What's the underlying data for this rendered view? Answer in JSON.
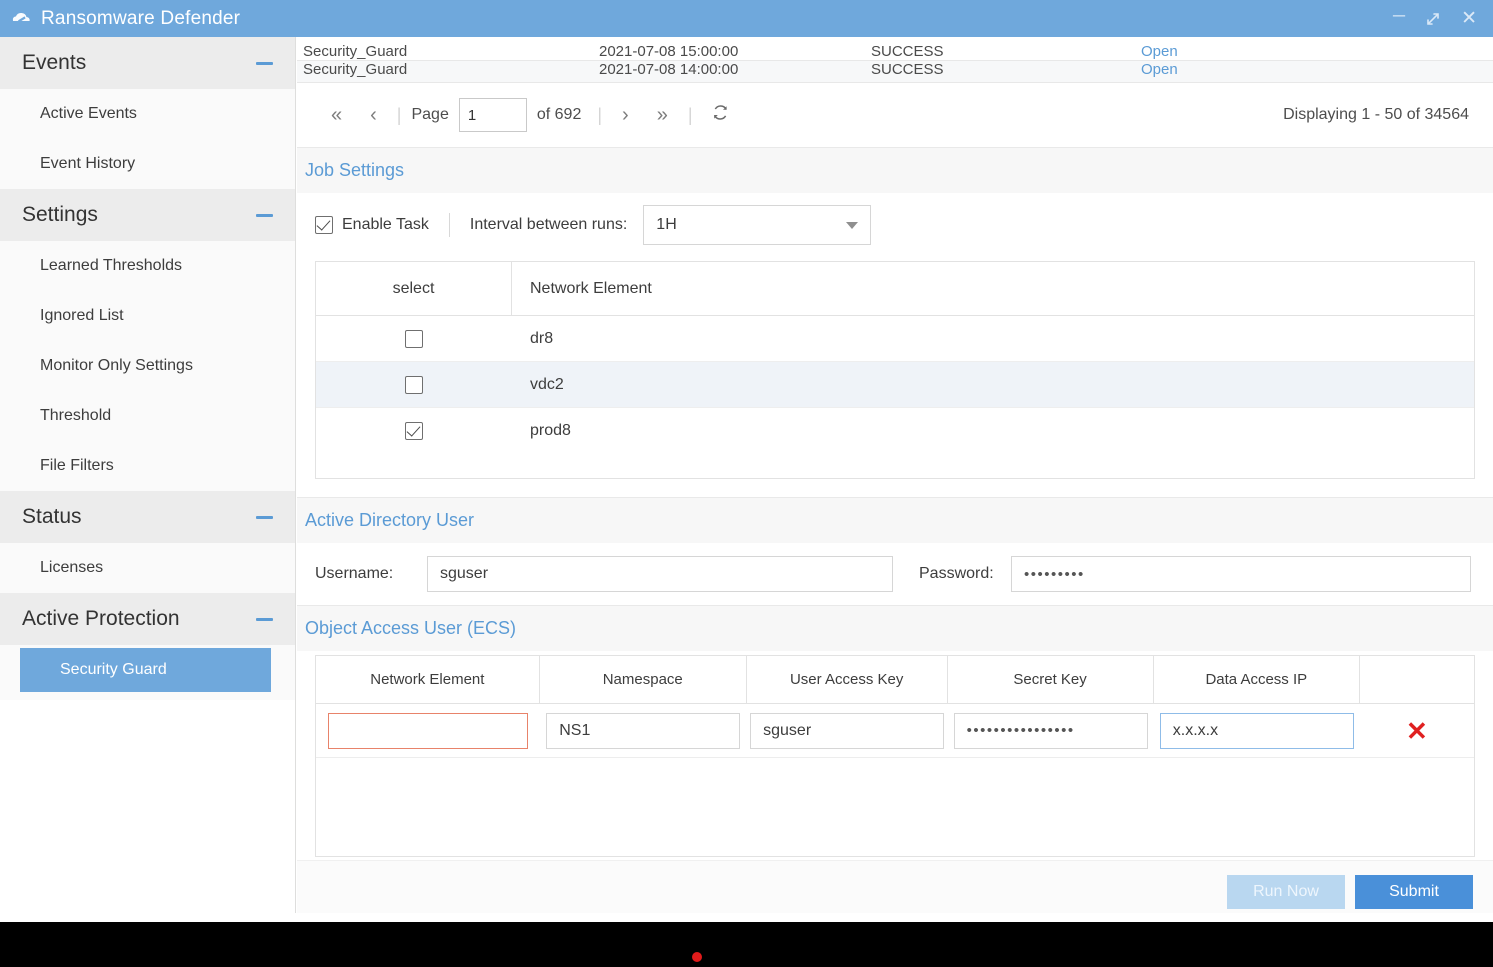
{
  "window": {
    "title": "Ransomware Defender",
    "icon": "shield-cloud-icon",
    "controls": {
      "minimize": "minimize-icon",
      "maximize": "maximize-icon",
      "close": "close-icon"
    },
    "titlebar_color": "#6fa8dc"
  },
  "sidebar": {
    "groups": [
      {
        "title": "Events",
        "collapse_icon": "minus-icon",
        "items": [
          {
            "label": "Active Events",
            "active": false
          },
          {
            "label": "Event History",
            "active": false
          }
        ]
      },
      {
        "title": "Settings",
        "collapse_icon": "minus-icon",
        "items": [
          {
            "label": "Learned Thresholds",
            "active": false
          },
          {
            "label": "Ignored List",
            "active": false
          },
          {
            "label": "Monitor Only Settings",
            "active": false
          },
          {
            "label": "Threshold",
            "active": false
          },
          {
            "label": "File Filters",
            "active": false
          }
        ]
      },
      {
        "title": "Status",
        "collapse_icon": "minus-icon",
        "items": [
          {
            "label": "Licenses",
            "active": false
          }
        ]
      },
      {
        "title": "Active Protection",
        "collapse_icon": "minus-icon",
        "items": [
          {
            "label": "Security Guard",
            "active": true
          }
        ]
      }
    ]
  },
  "events_table": {
    "rows": [
      {
        "name": "Security_Guard",
        "date": "2021-07-08 15:00:00",
        "status": "SUCCESS",
        "link": "Open"
      },
      {
        "name": "Security_Guard",
        "date": "2021-07-08 14:00:00",
        "status": "SUCCESS",
        "link": "Open"
      }
    ]
  },
  "pagination": {
    "first_icon": "first-page-icon",
    "prev_icon": "prev-page-icon",
    "page_label": "Page",
    "page_value": "1",
    "of_label": "of 692",
    "next_icon": "next-page-icon",
    "last_icon": "last-page-icon",
    "refresh_icon": "refresh-icon",
    "displaying": "Displaying 1 - 50 of 34564"
  },
  "job_settings": {
    "title": "Job Settings",
    "enable_task_label": "Enable Task",
    "enable_task_checked": true,
    "interval_label": "Interval between runs:",
    "interval_value": "1H",
    "network_elements_table": {
      "columns": [
        "select",
        "Network Element"
      ],
      "rows": [
        {
          "name": "dr8",
          "selected": false
        },
        {
          "name": "vdc2",
          "selected": false
        },
        {
          "name": "prod8",
          "selected": true
        }
      ]
    }
  },
  "active_directory_user": {
    "title": "Active Directory User",
    "username_label": "Username:",
    "username_value": "sguser",
    "password_label": "Password:",
    "password_value": "•••••••••"
  },
  "object_access_user": {
    "title": "Object Access User (ECS)",
    "columns": [
      "Network Element",
      "Namespace",
      "User Access Key",
      "Secret Key",
      "Data Access IP",
      ""
    ],
    "rows": [
      {
        "network_element": "",
        "namespace": "NS1",
        "user_access_key": "sguser",
        "secret_key": "••••••••••••••••",
        "data_access_ip": "x.x.x.x",
        "delete_icon": "delete-row-icon"
      }
    ]
  },
  "footer": {
    "run_now_label": "Run Now",
    "submit_label": "Submit"
  },
  "colors": {
    "accent": "#5b9bd5",
    "titlebar": "#6fa8dc",
    "primary_button": "#4a90d9",
    "secondary_button": "#b9d7f0",
    "error_border": "#e8836a",
    "delete_red": "#e02020"
  }
}
